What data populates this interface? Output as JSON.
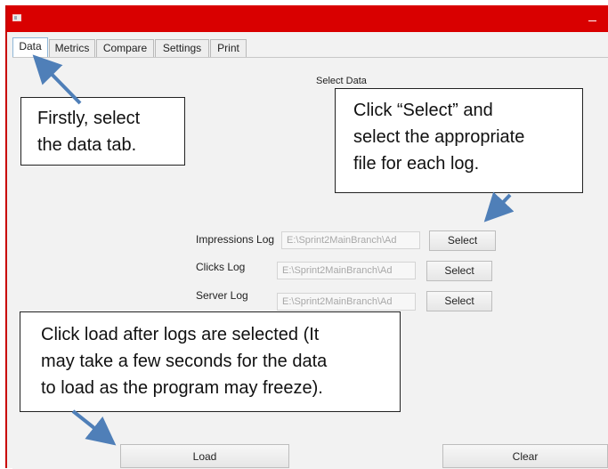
{
  "window": {
    "title": ""
  },
  "tabs": [
    {
      "label": "Data"
    },
    {
      "label": "Metrics"
    },
    {
      "label": "Compare"
    },
    {
      "label": "Settings"
    },
    {
      "label": "Print"
    }
  ],
  "panel": {
    "heading": "Select Data",
    "logs": [
      {
        "label": "Impressions Log",
        "path": "E:\\Sprint2MainBranch\\Ad",
        "button": "Select"
      },
      {
        "label": "Clicks Log",
        "path": "E:\\Sprint2MainBranch\\Ad",
        "button": "Select"
      },
      {
        "label": "Server Log",
        "path": "E:\\Sprint2MainBranch\\Ad",
        "button": "Select"
      }
    ],
    "load_label": "Load",
    "clear_label": "Clear"
  },
  "annotations": {
    "data_tab_note": [
      "Firstly, select",
      "the data tab."
    ],
    "select_note": [
      "Click “Select” and",
      "select the appropriate",
      "file for each log."
    ],
    "load_note": [
      "Click load after logs are selected (It",
      "may take a few seconds for the data",
      "to load as the program may freeze)."
    ]
  },
  "colors": {
    "titlebar": "#d90000",
    "arrow": "#4f7fb8",
    "active_tab_border": "#8fb6d8"
  },
  "icons": {
    "app": "window-icon",
    "minimize": "minimize-icon"
  }
}
